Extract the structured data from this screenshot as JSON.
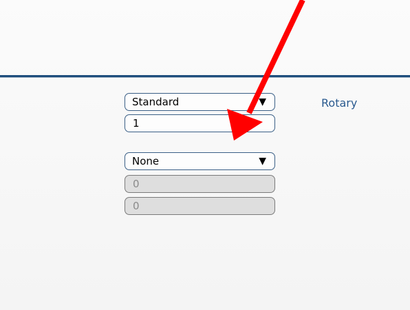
{
  "form": {
    "type_select": {
      "value": "Standard",
      "arrow": "▼"
    },
    "number_input": {
      "value": "1"
    },
    "mode_select": {
      "value": "None",
      "arrow": "▼"
    },
    "disabled_input_1": {
      "value": "0"
    },
    "disabled_input_2": {
      "value": "0"
    }
  },
  "side_link": {
    "label": "Rotary"
  },
  "annotation": {
    "color": "#ff0000",
    "icon": "red-arrow"
  },
  "colors": {
    "header_rule": "#1e4e7d",
    "field_border": "#3a5f86",
    "link": "#2a5a8f"
  }
}
